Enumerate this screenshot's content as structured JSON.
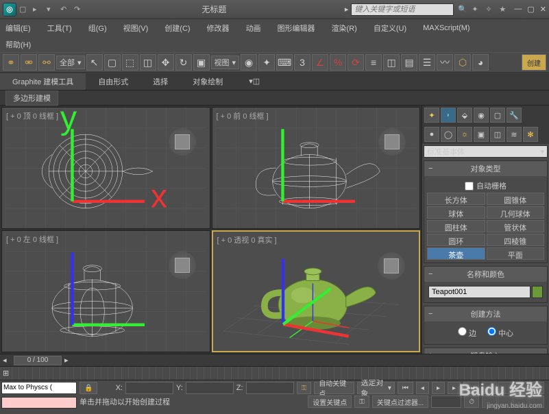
{
  "title": "无标题",
  "search_placeholder": "键入关键字或短语",
  "menu": {
    "edit": "编辑(E)",
    "tools": "工具(T)",
    "group": "组(G)",
    "views": "视图(V)",
    "create": "创建(C)",
    "modifiers": "修改器",
    "animation": "动画",
    "graph": "图形编辑器",
    "rendering": "渲染(R)",
    "customize": "自定义(U)",
    "maxscript": "MAXScript(M)",
    "help": "帮助(H)"
  },
  "toolbar": {
    "all_filter": "全部",
    "view_label": "视图"
  },
  "ribbon": {
    "tab1": "Graphite 建模工具",
    "tab2": "自由形式",
    "tab3": "选择",
    "tab4": "对象绘制",
    "subtab": "多边形建模"
  },
  "viewports": {
    "top": "[ + 0 顶 0 线框 ]",
    "front": "[ + 0 前 0 线框 ]",
    "left": "[ + 0 左 0 线框 ]",
    "persp": "[ + 0 透视 0 真实 ]"
  },
  "panel": {
    "category": "标准基本体",
    "rollout_objtype": "对象类型",
    "autogrid": "自动栅格",
    "primitives": {
      "box": "长方体",
      "cone": "圆锥体",
      "sphere": "球体",
      "geosphere": "几何球体",
      "cylinder": "圆柱体",
      "tube": "管状体",
      "torus": "圆环",
      "pyramid": "四棱锥",
      "teapot": "茶壶",
      "plane": "平面"
    },
    "rollout_name": "名称和颜色",
    "object_name": "Teapot001",
    "rollout_method": "创建方法",
    "edge": "边",
    "center": "中心",
    "rollout_keyboard": "键盘输入"
  },
  "time": {
    "slider": "0 / 100"
  },
  "status": {
    "script": "Max to Physcs (",
    "prompt": "单击并拖动以开始创建过程",
    "autokey": "自动关键点",
    "setkey": "设置关键点",
    "selected": "选定对象",
    "keyfilter": "关键点过滤器..."
  },
  "watermark": {
    "logo": "Baidu 经验",
    "url": "jingyan.baidu.com"
  },
  "chart_data": null
}
